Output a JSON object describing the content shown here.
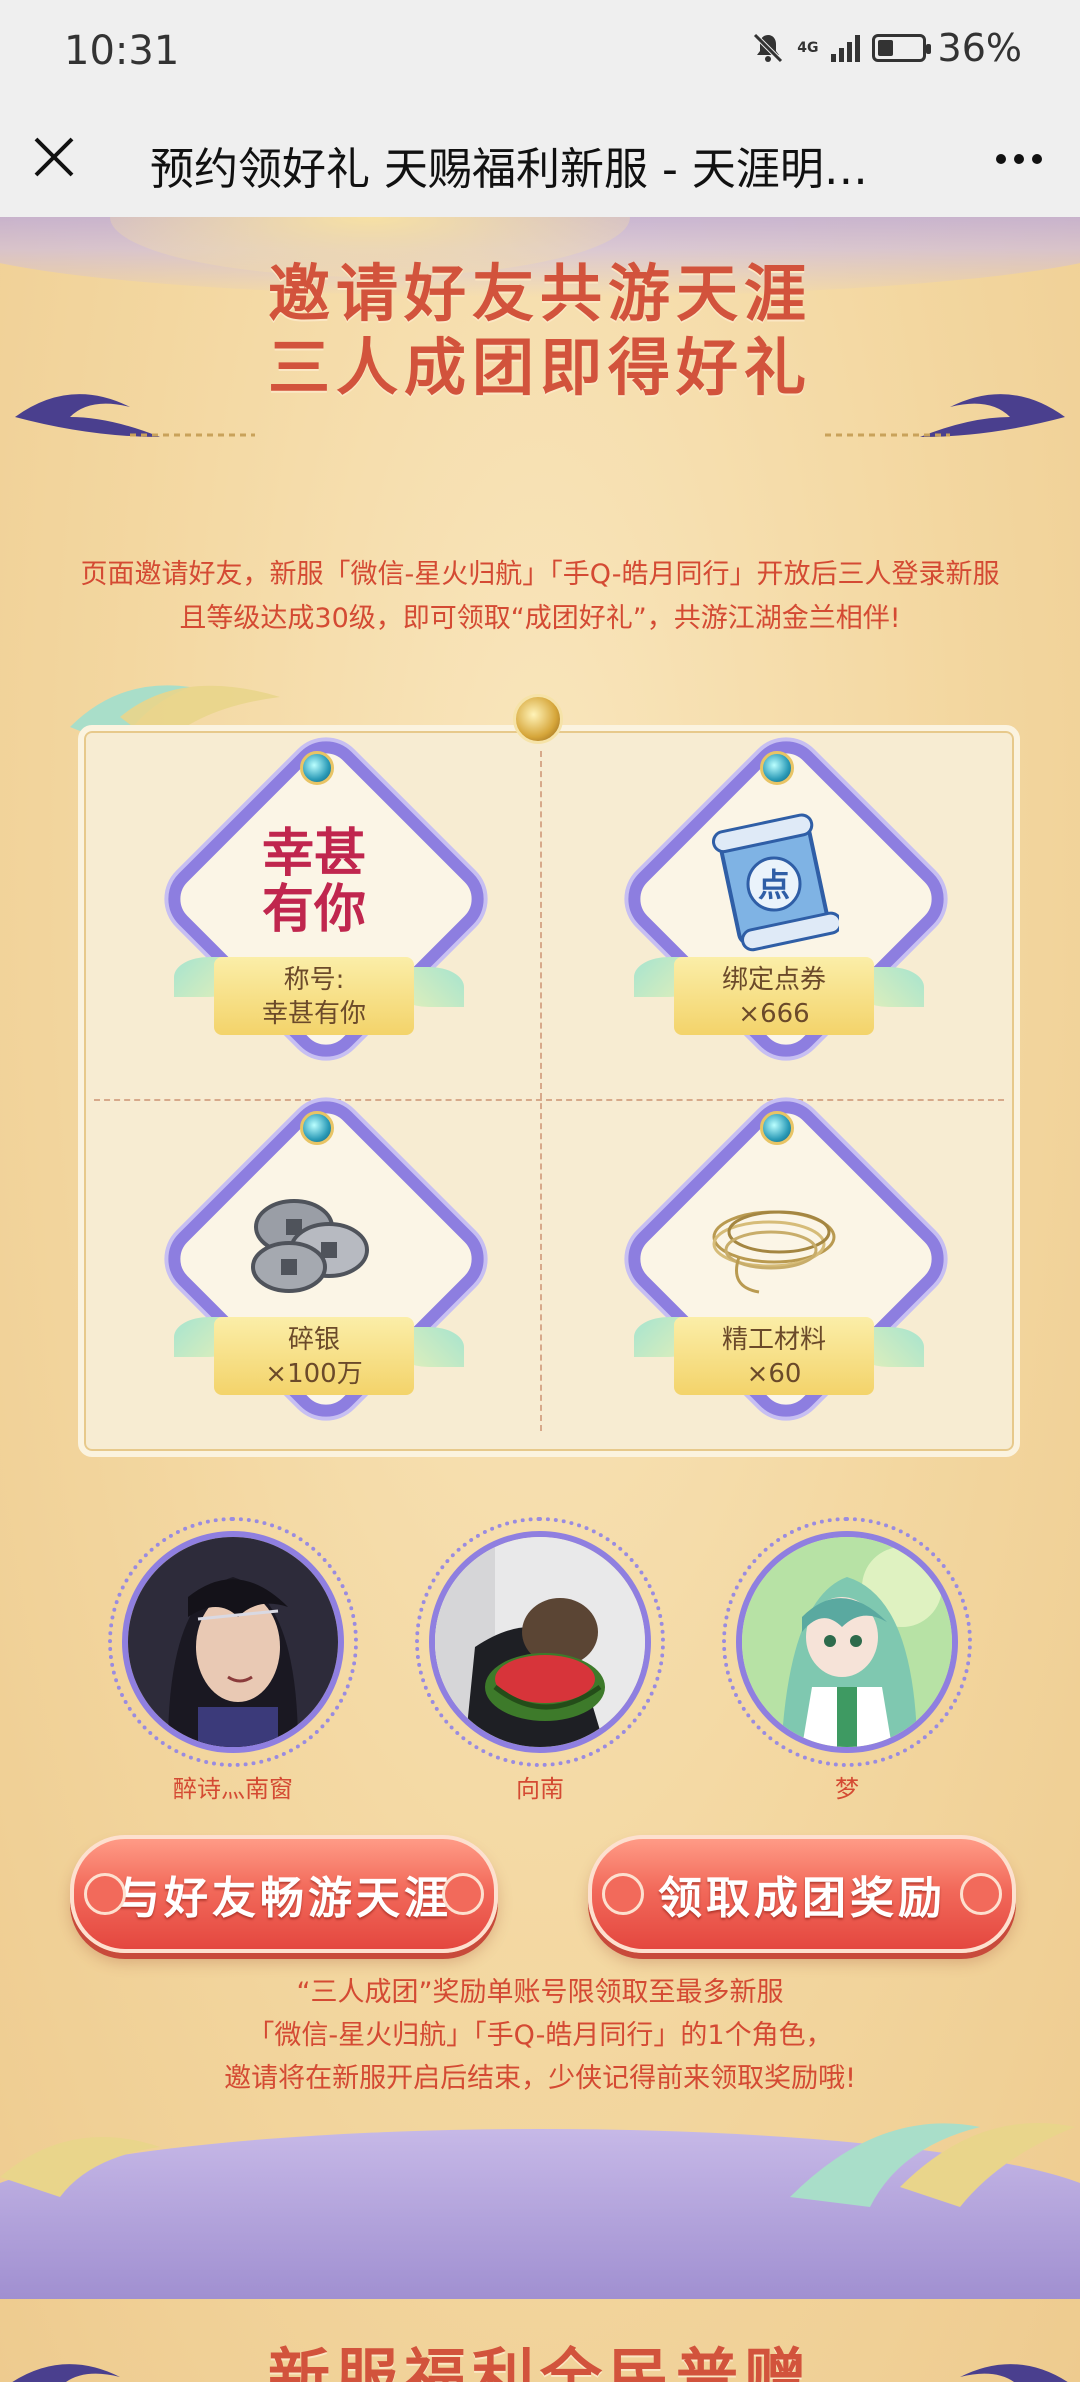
{
  "status_bar": {
    "time": "10:31",
    "network": "4G",
    "battery": "36%",
    "battery_level": 0.36
  },
  "title_bar": {
    "title": "预约领好礼 天赐福利新服 - 天涯明…"
  },
  "invite": {
    "heading_line1": "邀请好友共游天涯",
    "heading_line2": "三人成团即得好礼",
    "desc_line1": "页面邀请好友，新服「微信-星火归航」「手Q-皓月同行」开放后三人登录新服",
    "desc_line2": "且等级达成30级，即可领取“成团好礼”，共游江湖金兰相伴!"
  },
  "rewards": [
    {
      "art_text": "幸甚有你",
      "line1": "称号:",
      "line2": "幸甚有你",
      "icon": "calligraphy-title-icon"
    },
    {
      "art_text": "点",
      "line1": "绑定点券",
      "line2": "×666",
      "icon": "scroll-voucher-icon"
    },
    {
      "line1": "碎银",
      "line2": "×100万",
      "icon": "silver-coins-icon"
    },
    {
      "line1": "精工材料",
      "line2": "×60",
      "icon": "golden-thread-icon"
    }
  ],
  "team": [
    {
      "name": "醉诗灬南窗",
      "avatar": "male-character-avatar"
    },
    {
      "name": "向南",
      "avatar": "photo-watermelon-avatar"
    },
    {
      "name": "梦",
      "avatar": "green-hair-girl-avatar"
    }
  ],
  "buttons": {
    "invite": "与好友畅游天涯",
    "claim": "领取成团奖励"
  },
  "note": {
    "line1": "“三人成团”奖励单账号限领取至最多新服",
    "line2": "「微信-星火归航」「手Q-皓月同行」的1个角色，",
    "line3": "邀请将在新服开启后结束，少侠记得前来领取奖励哦!"
  },
  "next_section": {
    "heading": "新服福利全民普赠"
  }
}
